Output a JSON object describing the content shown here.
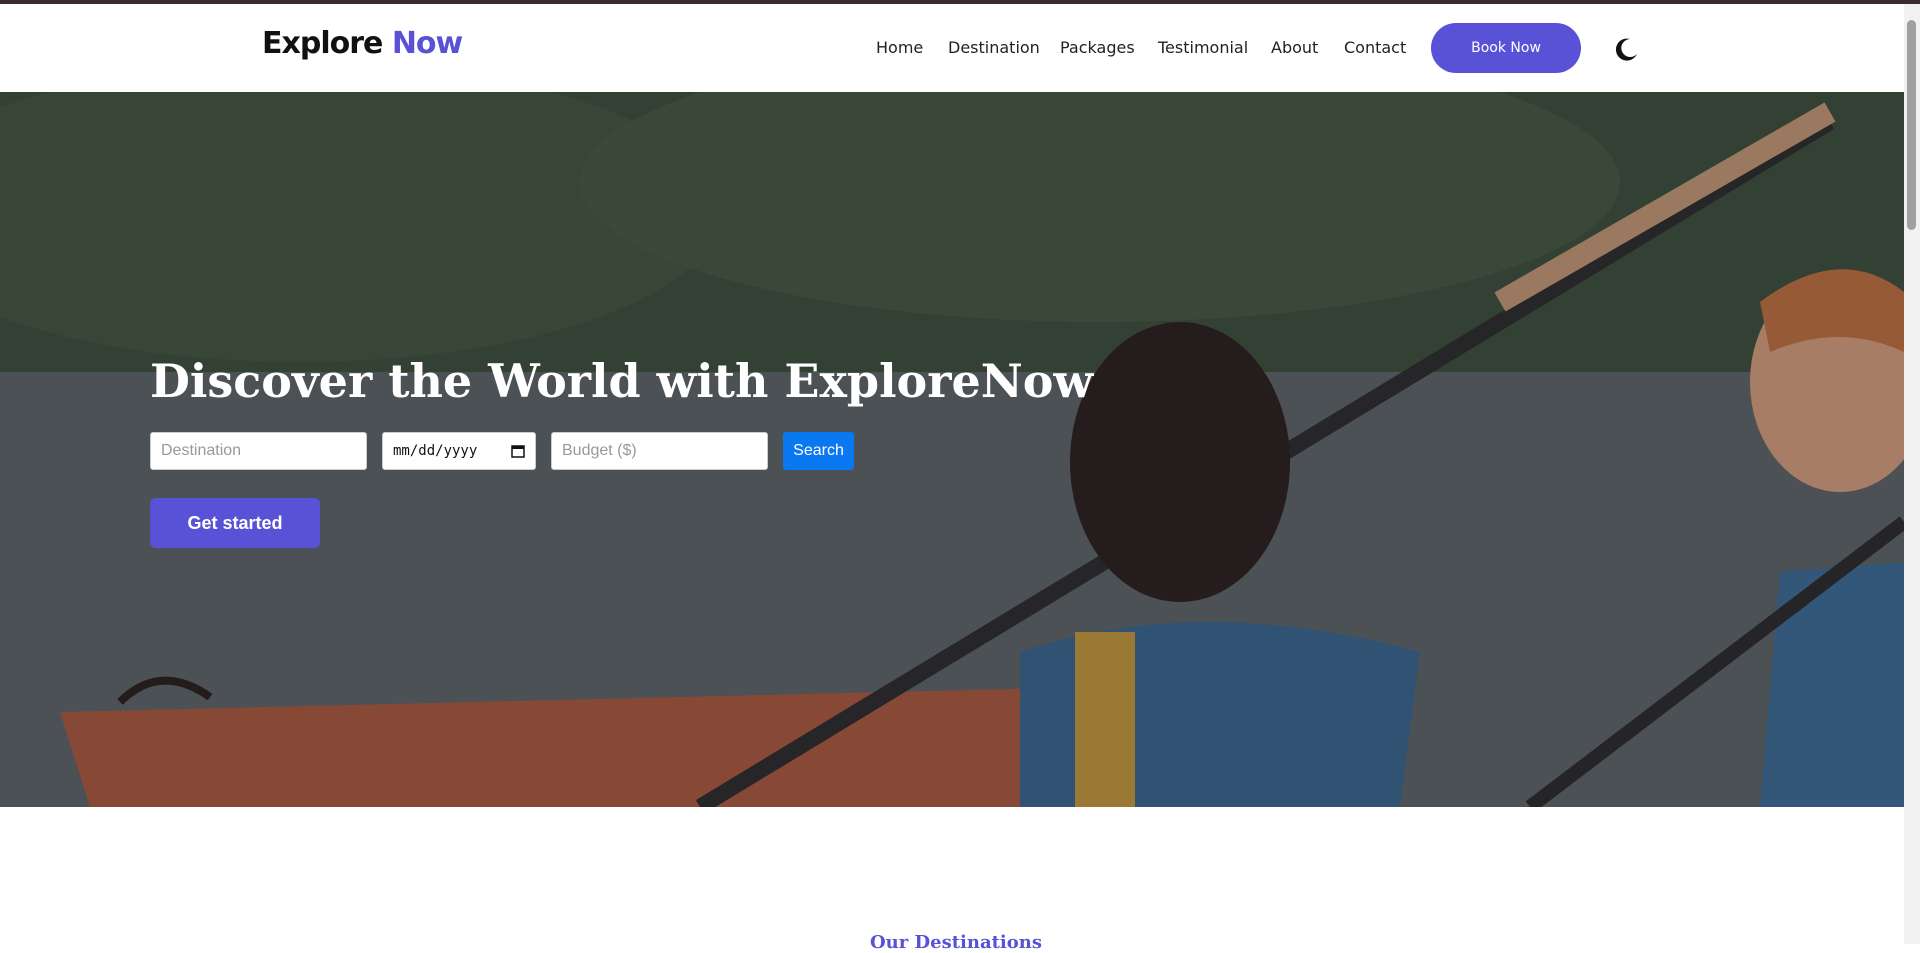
{
  "brand": {
    "part1": "Explore",
    "part2": "Now"
  },
  "nav": {
    "items": [
      {
        "label": "Home"
      },
      {
        "label": "Destination"
      },
      {
        "label": "Packages"
      },
      {
        "label": "Testimonial"
      },
      {
        "label": "About"
      },
      {
        "label": "Contact"
      }
    ],
    "book_label": "Book Now",
    "theme_icon": "moon-icon"
  },
  "hero": {
    "title": "Discover the World with ExploreNow",
    "destination_placeholder": "Destination",
    "date_value": "mm/dd/yyyy",
    "budget_placeholder": "Budget ($)",
    "search_label": "Search",
    "cta_label": "Get started"
  },
  "next_section": {
    "title": "Our Destinations"
  },
  "colors": {
    "accent": "#5a52d6",
    "search_blue": "#0a78f0"
  }
}
